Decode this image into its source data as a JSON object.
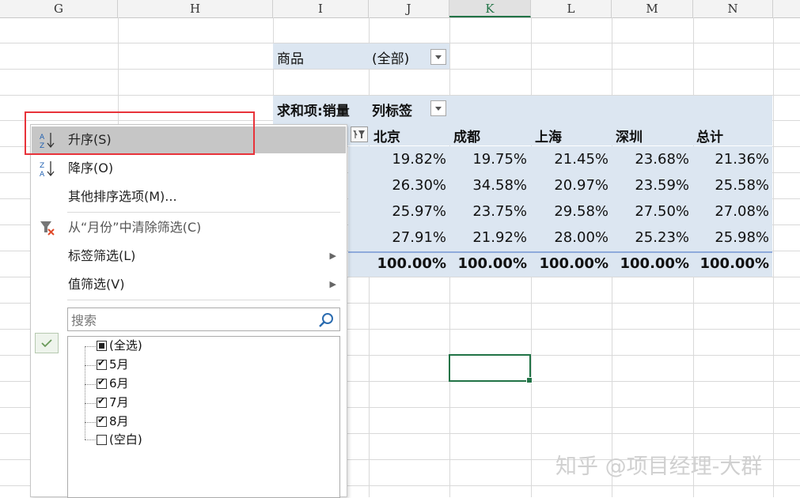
{
  "columns": [
    "G",
    "H",
    "I",
    "J",
    "K",
    "L",
    "M",
    "N"
  ],
  "selected_column": "K",
  "pivot": {
    "filter_field": "商品",
    "filter_value": "(全部)",
    "value_field": "求和项:销量",
    "col_label": "列标签",
    "headers": [
      "北京",
      "成都",
      "上海",
      "深圳",
      "总计"
    ],
    "rows": [
      [
        "19.82%",
        "19.75%",
        "21.45%",
        "23.68%",
        "21.36%"
      ],
      [
        "26.30%",
        "34.58%",
        "20.97%",
        "23.59%",
        "25.58%"
      ],
      [
        "25.97%",
        "23.75%",
        "29.58%",
        "27.50%",
        "27.08%"
      ],
      [
        "27.91%",
        "21.92%",
        "28.00%",
        "25.23%",
        "25.98%"
      ]
    ],
    "totals": [
      "100.00%",
      "100.00%",
      "100.00%",
      "100.00%",
      "100.00%"
    ]
  },
  "menu": {
    "sort_asc": "升序(S)",
    "sort_desc": "降序(O)",
    "more_sort": "其他排序选项(M)...",
    "clear_filter": "从“月份”中清除筛选(C)",
    "label_filter": "标签筛选(L)",
    "value_filter": "值筛选(V)",
    "search_placeholder": "搜索",
    "items": [
      {
        "label": "(全选)",
        "state": "partial"
      },
      {
        "label": "5月",
        "state": "checked"
      },
      {
        "label": "6月",
        "state": "checked"
      },
      {
        "label": "7月",
        "state": "checked"
      },
      {
        "label": "8月",
        "state": "checked"
      },
      {
        "label": "(空白)",
        "state": "unchecked"
      }
    ]
  },
  "watermark": "知乎 @项目经理-大群",
  "colors": {
    "accent": "#217346",
    "pivot_band": "#dce6f1",
    "highlight_box": "#e8333a"
  }
}
